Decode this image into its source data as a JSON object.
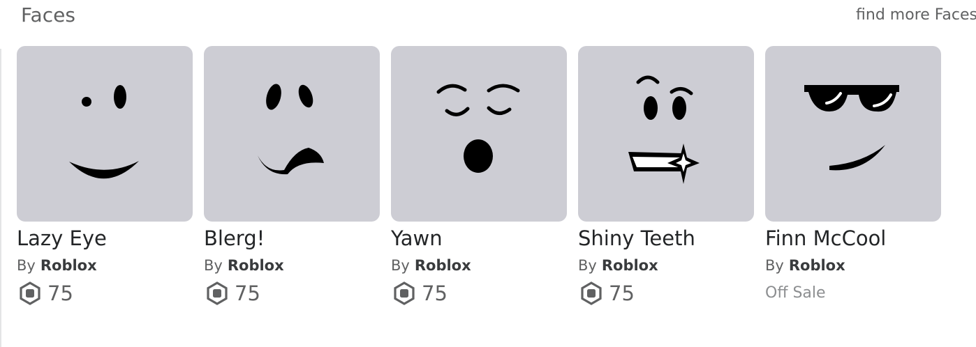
{
  "section": {
    "title": "Faces",
    "see_more_top": "",
    "see_more": "find more Faces"
  },
  "items": [
    {
      "name": "Lazy Eye",
      "by": "By",
      "creator": "Roblox",
      "price": "75",
      "icon": "lazy-eye-face-icon"
    },
    {
      "name": "Blerg!",
      "by": "By",
      "creator": "Roblox",
      "price": "75",
      "icon": "blerg-face-icon"
    },
    {
      "name": "Yawn",
      "by": "By",
      "creator": "Roblox",
      "price": "75",
      "icon": "yawn-face-icon"
    },
    {
      "name": "Shiny Teeth",
      "by": "By",
      "creator": "Roblox",
      "price": "75",
      "icon": "shiny-teeth-face-icon"
    },
    {
      "name": "Finn McCool",
      "by": "By",
      "creator": "Roblox",
      "status": "Off Sale",
      "icon": "finn-mccool-face-icon"
    }
  ],
  "colors": {
    "thumbnail_bg": "#cdcdd4",
    "text_primary": "#232527",
    "text_secondary": "#606162",
    "off_sale": "#8c8e90"
  },
  "currency_icon": "robux-icon"
}
